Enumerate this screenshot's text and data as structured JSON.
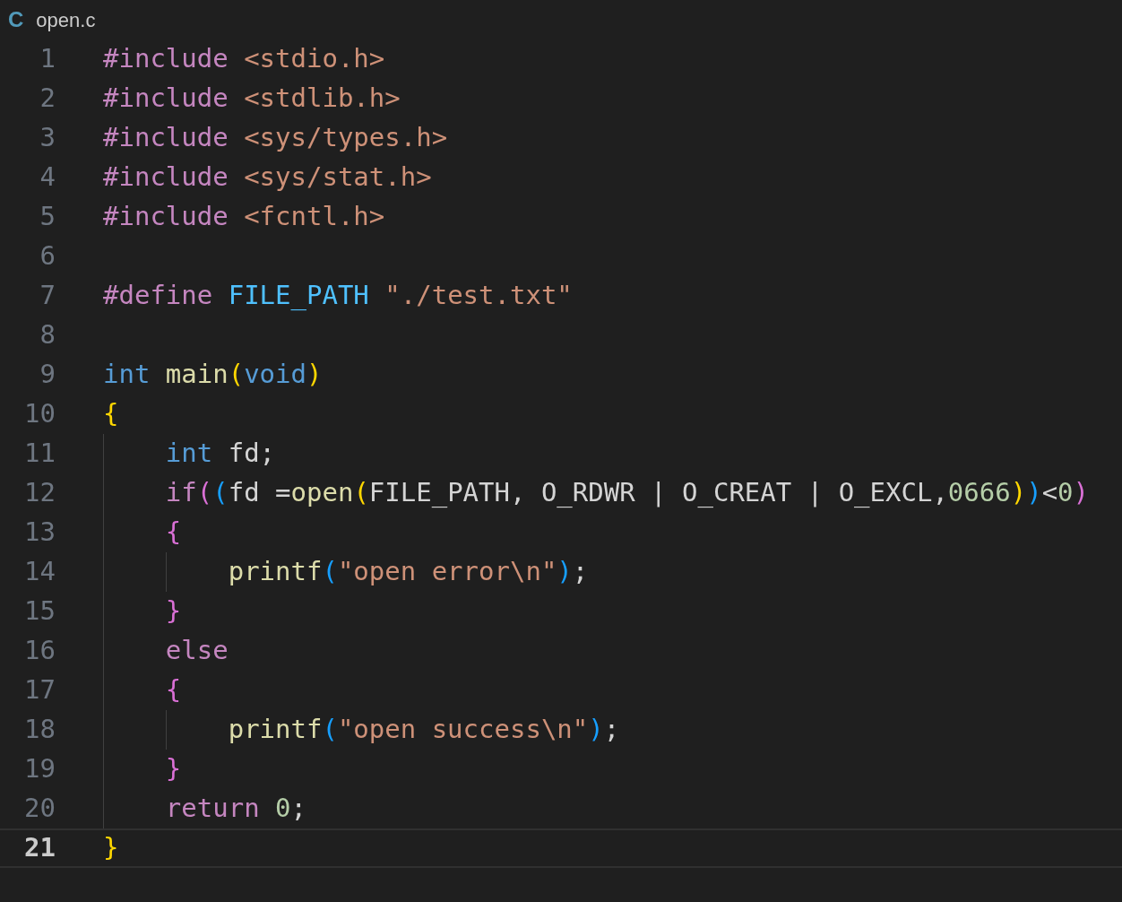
{
  "tab": {
    "file_icon": "C",
    "title": "open.c"
  },
  "lines": [
    {
      "number": "1",
      "current": false,
      "tokens": [
        {
          "text": "#include ",
          "kind": "preprocessor"
        },
        {
          "text": "<stdio.h>",
          "kind": "string"
        }
      ]
    },
    {
      "number": "2",
      "current": false,
      "tokens": [
        {
          "text": "#include ",
          "kind": "preprocessor"
        },
        {
          "text": "<stdlib.h>",
          "kind": "string"
        }
      ]
    },
    {
      "number": "3",
      "current": false,
      "tokens": [
        {
          "text": "#include ",
          "kind": "preprocessor"
        },
        {
          "text": "<sys/types.h>",
          "kind": "string"
        }
      ]
    },
    {
      "number": "4",
      "current": false,
      "tokens": [
        {
          "text": "#include ",
          "kind": "preprocessor"
        },
        {
          "text": "<sys/stat.h>",
          "kind": "string"
        }
      ]
    },
    {
      "number": "5",
      "current": false,
      "tokens": [
        {
          "text": "#include ",
          "kind": "preprocessor"
        },
        {
          "text": "<fcntl.h>",
          "kind": "string"
        }
      ]
    },
    {
      "number": "6",
      "current": false
    },
    {
      "number": "7",
      "current": false,
      "tokens": [
        {
          "text": "#define ",
          "kind": "preprocessor"
        },
        {
          "text": "FILE_PATH ",
          "kind": "macro"
        },
        {
          "text": "\"./test.txt\"",
          "kind": "string"
        }
      ]
    },
    {
      "number": "8",
      "current": false
    },
    {
      "number": "9",
      "current": false,
      "tokens": [
        {
          "text": "int ",
          "kind": "keyword"
        },
        {
          "text": "main",
          "kind": "function"
        },
        {
          "text": "(",
          "kind": "bracket1"
        },
        {
          "text": "void",
          "kind": "keyword"
        },
        {
          "text": ")",
          "kind": "bracket1"
        }
      ]
    },
    {
      "number": "10",
      "current": false,
      "tokens": [
        {
          "text": "{",
          "kind": "bracket1"
        }
      ]
    },
    {
      "number": "11",
      "current": false,
      "tokens": [
        {
          "text": "    int",
          "kind": "keyword"
        },
        {
          "text": " fd;",
          "kind": "plain"
        }
      ]
    },
    {
      "number": "12",
      "current": false,
      "tokens": [
        {
          "text": "    if",
          "kind": "control"
        },
        {
          "text": "(",
          "kind": "bracket2"
        },
        {
          "text": "(",
          "kind": "bracket3"
        },
        {
          "text": "fd =",
          "kind": "plain"
        },
        {
          "text": "open",
          "kind": "function"
        },
        {
          "text": "(",
          "kind": "bracket1"
        },
        {
          "text": "FILE_PATH, O_RDWR | O_CREAT | O_EXCL,",
          "kind": "plain"
        },
        {
          "text": "0666",
          "kind": "number"
        },
        {
          "text": ")",
          "kind": "bracket1"
        },
        {
          "text": ")",
          "kind": "bracket3"
        },
        {
          "text": "<",
          "kind": "plain"
        },
        {
          "text": "0",
          "kind": "number"
        },
        {
          "text": ")",
          "kind": "bracket2"
        }
      ]
    },
    {
      "number": "13",
      "current": false,
      "tokens": [
        {
          "text": "    {",
          "kind": "bracket2"
        }
      ]
    },
    {
      "number": "14",
      "current": false,
      "tokens": [
        {
          "text": "        printf",
          "kind": "function"
        },
        {
          "text": "(",
          "kind": "bracket3"
        },
        {
          "text": "\"open error\\n\"",
          "kind": "string"
        },
        {
          "text": ")",
          "kind": "bracket3"
        },
        {
          "text": ";",
          "kind": "plain"
        }
      ]
    },
    {
      "number": "15",
      "current": false,
      "tokens": [
        {
          "text": "    }",
          "kind": "bracket2"
        }
      ]
    },
    {
      "number": "16",
      "current": false,
      "tokens": [
        {
          "text": "    else",
          "kind": "control"
        }
      ]
    },
    {
      "number": "17",
      "current": false,
      "tokens": [
        {
          "text": "    {",
          "kind": "bracket2"
        }
      ]
    },
    {
      "number": "18",
      "current": false,
      "tokens": [
        {
          "text": "        printf",
          "kind": "function"
        },
        {
          "text": "(",
          "kind": "bracket3"
        },
        {
          "text": "\"open success\\n\"",
          "kind": "string"
        },
        {
          "text": ")",
          "kind": "bracket3"
        },
        {
          "text": ";",
          "kind": "plain"
        }
      ]
    },
    {
      "number": "19",
      "current": false,
      "tokens": [
        {
          "text": "    }",
          "kind": "bracket2"
        }
      ]
    },
    {
      "number": "20",
      "current": false,
      "tokens": [
        {
          "text": "    return ",
          "kind": "control"
        },
        {
          "text": "0",
          "kind": "number"
        },
        {
          "text": ";",
          "kind": "plain"
        }
      ]
    },
    {
      "number": "21",
      "current": true,
      "tokens": [
        {
          "text": "}",
          "kind": "bracket1"
        }
      ]
    }
  ]
}
